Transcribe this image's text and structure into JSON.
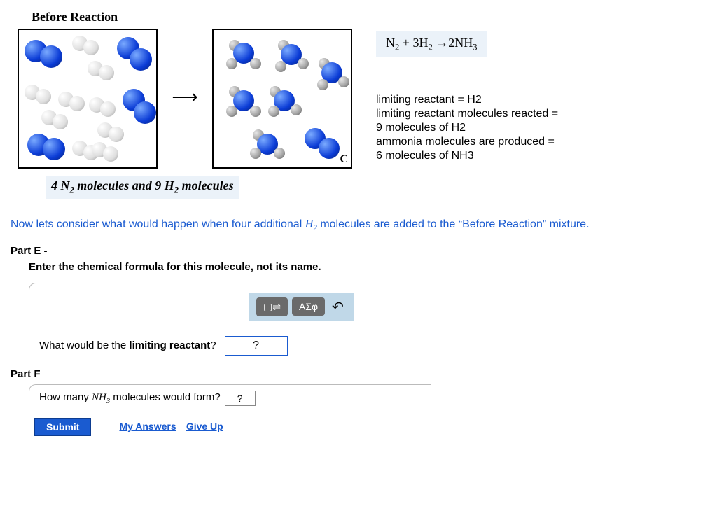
{
  "heading": "Before Reaction",
  "equation_html": "N<sub>2</sub> + 3H<sub>2</sub> →2NH<sub>3</sub>",
  "facts": {
    "line1": "limiting reactant = H2",
    "line2": "limiting reactant molecules reacted =",
    "line3": "9 molecules of H2",
    "line4": "ammonia molecules are produced =",
    "line5": "6 molecules of NH3"
  },
  "caption_html": "4 N<sub>2</sub> molecules and  9 H<sub>2</sub> molecules",
  "box_after_label": "C",
  "blue_line": {
    "before": "Now lets consider what would happen when four additional ",
    "mol_html": "H<sub>2</sub>",
    "after": " molecules are added to the “Before Reaction” mixture."
  },
  "partE": {
    "heading": "Part E -",
    "sub": "Enter the chemical formula for this molecule, not its name.",
    "toolbar": {
      "btn1": "▢⇌",
      "btn2": "ΑΣφ",
      "undo": "↶"
    },
    "question_html": "What would be the <b>limiting reactant</b>?",
    "placeholder": "?"
  },
  "partF": {
    "heading": "Part F",
    "question_html": "How many <span style='font-style:italic;font-family:\"Times New Roman\",serif;'>NH<sub>3</sub></span> molecules would form?",
    "placeholder": "?"
  },
  "buttons": {
    "submit": "Submit",
    "my_answers": "My Answers",
    "give_up": "Give Up"
  }
}
